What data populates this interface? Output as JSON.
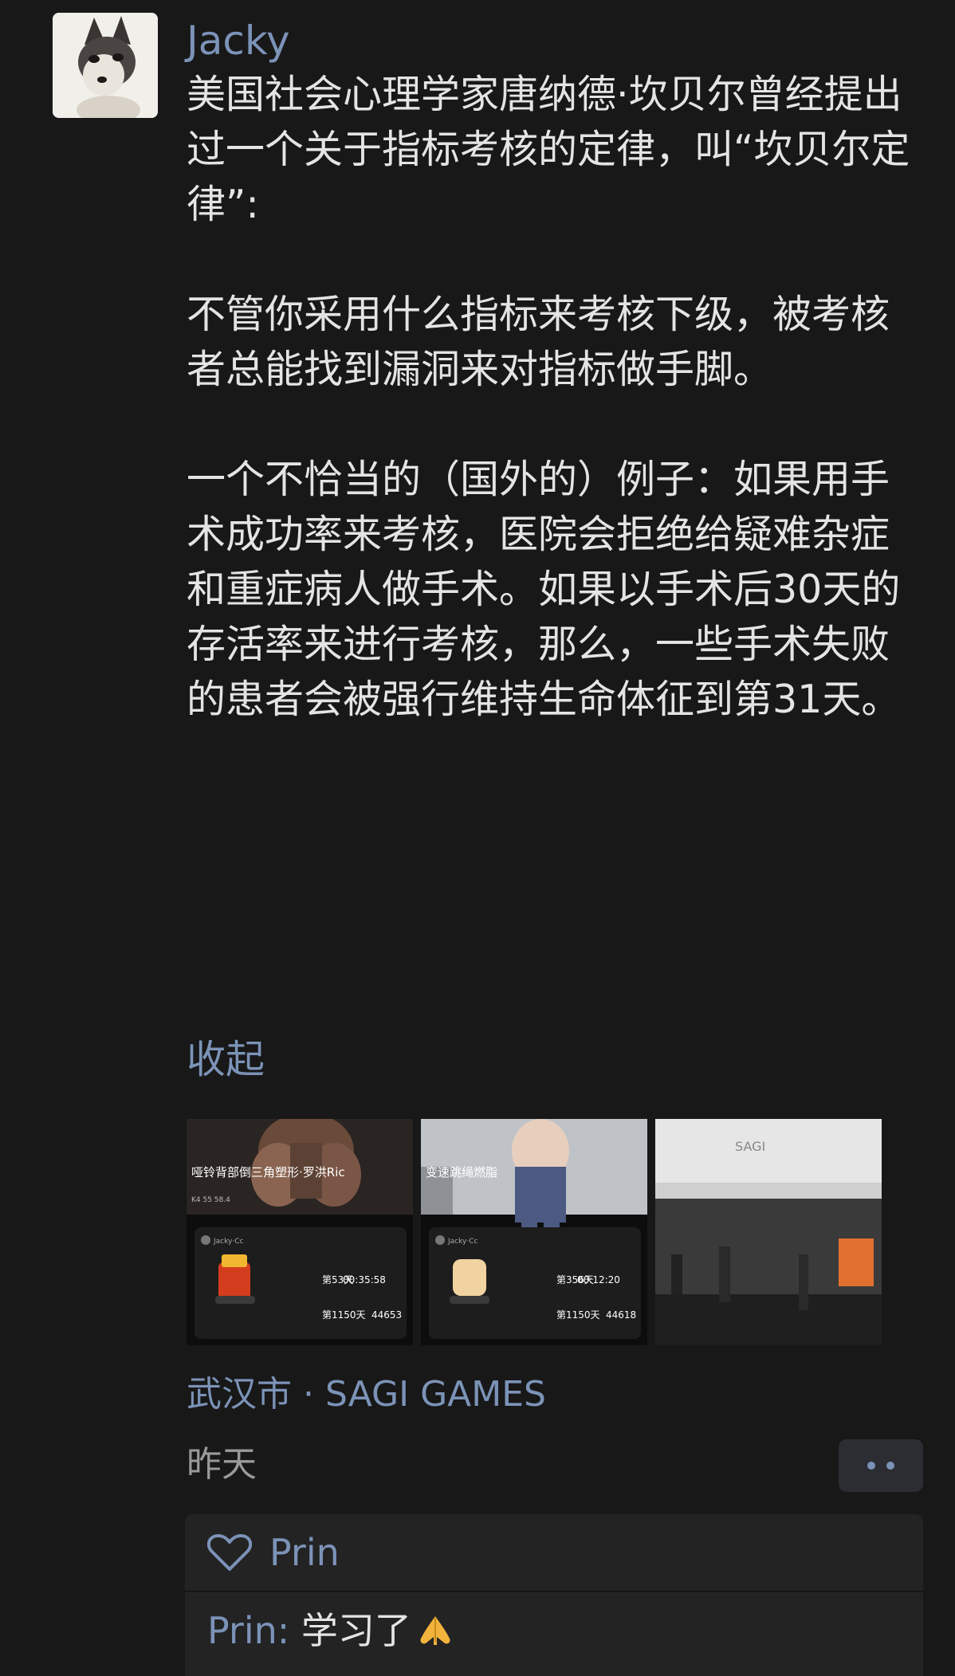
{
  "post": {
    "author": "Jacky",
    "avatar_icon": "husky-dog-avatar",
    "paragraphs": [
      "美国社会心理学家唐纳德·坎贝尔曾经提出过一个关于指标考核的定律，叫“坎贝尔定律”:",
      "不管你采用什么指标来考核下级，被考核者总能找到漏洞来对指标做手脚。",
      "一个不恰当的（国外的）例子：如果用手术成功率来考核，医院会拒绝给疑难杂症和重症病人做手术。如果以手术后30天的存活率来进行考核，那么，一些手术失败的患者会被强行维持生命体征到第31天。"
    ],
    "collapse_label": "收起",
    "images": [
      {
        "title": "哑铃背部倒三角塑形·罗洪Ric",
        "user": "Jacky·Cc",
        "stat_a": "第53天",
        "stat_b": "00:35:58",
        "stat_c": "第1150天",
        "stat_d": "44653"
      },
      {
        "title": "变速跳绳燃脂",
        "user": "Jacky·Cc",
        "stat_a": "第356天",
        "stat_b": "00:12:20",
        "stat_c": "第1150天",
        "stat_d": "44618"
      },
      {
        "title": "",
        "sign": "SAGI"
      }
    ],
    "location": "武汉市 · SAGI GAMES",
    "time": "昨天",
    "more_icon": "more-dots-icon"
  },
  "interactions": {
    "likes": "Prin",
    "comments": [
      {
        "author": "Prin",
        "separator": ": ",
        "text": "学习了",
        "emoji": "pray-hands-emoji"
      }
    ]
  },
  "colors": {
    "background": "#181818",
    "link": "#7c93b8",
    "text": "#e4e4e4",
    "panel": "#232323"
  }
}
